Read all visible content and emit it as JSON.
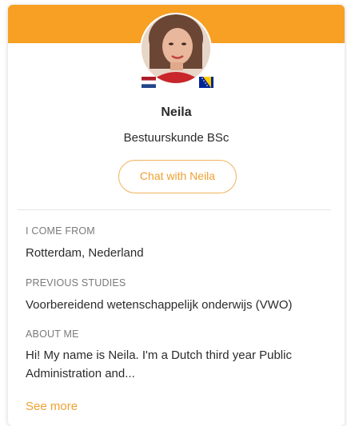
{
  "profile": {
    "name": "Neila",
    "study": "Bestuurskunde BSc",
    "chat_label": "Chat with Neila",
    "flags": [
      "netherlands-flag",
      "bosnia-flag"
    ]
  },
  "sections": {
    "from": {
      "label": "I COME FROM",
      "value": "Rotterdam, Nederland"
    },
    "previous": {
      "label": "PREVIOUS STUDIES",
      "value": "Voorbereidend wetenschappelijk onderwijs (VWO)"
    },
    "about": {
      "label": "ABOUT ME",
      "value": "Hi! My name is Neila. I'm a Dutch third year Public Administration and..."
    }
  },
  "see_more_label": "See more",
  "colors": {
    "accent": "#f7a023",
    "accent_text": "#f0a030",
    "text": "#2b2b2b",
    "muted": "#7a7a7a"
  }
}
